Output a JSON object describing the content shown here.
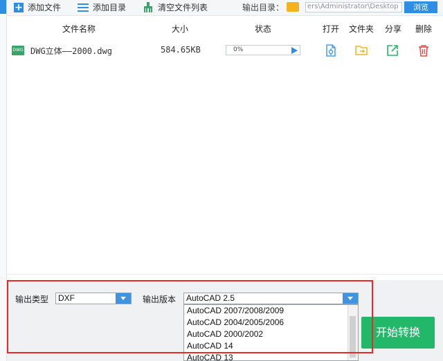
{
  "toolbar": {
    "add_file": "添加文件",
    "add_dir": "添加目录",
    "clear_list": "清空文件列表",
    "output_dir_label": "输出目录：",
    "output_path": "ers\\Administrator\\Desktop",
    "browse": "浏览"
  },
  "columns": {
    "name": "文件名称",
    "size": "大小",
    "status": "状态",
    "open": "打开",
    "folder": "文件夹",
    "share": "分享",
    "delete": "删除"
  },
  "file": {
    "badge": "DWG",
    "name": "DWG立体——2000.dwg",
    "size": "584.65KB",
    "progress_text": "0%"
  },
  "bottom": {
    "output_type_label": "输出类型",
    "output_type_value": "DXF",
    "output_version_label": "输出版本",
    "output_version_value": "AutoCAD 2.5",
    "version_options": [
      "AutoCAD 2007/2008/2009",
      "AutoCAD 2004/2005/2006",
      "AutoCAD 2000/2002",
      "AutoCAD 14",
      "AutoCAD 13"
    ],
    "convert_label": "开始转换"
  },
  "colors": {
    "accent": "#2d8ee6",
    "folder_yellow": "#f5b31b",
    "share_green": "#23b76a",
    "delete_red": "#e84c4c",
    "highlight_border": "#e8282b"
  }
}
